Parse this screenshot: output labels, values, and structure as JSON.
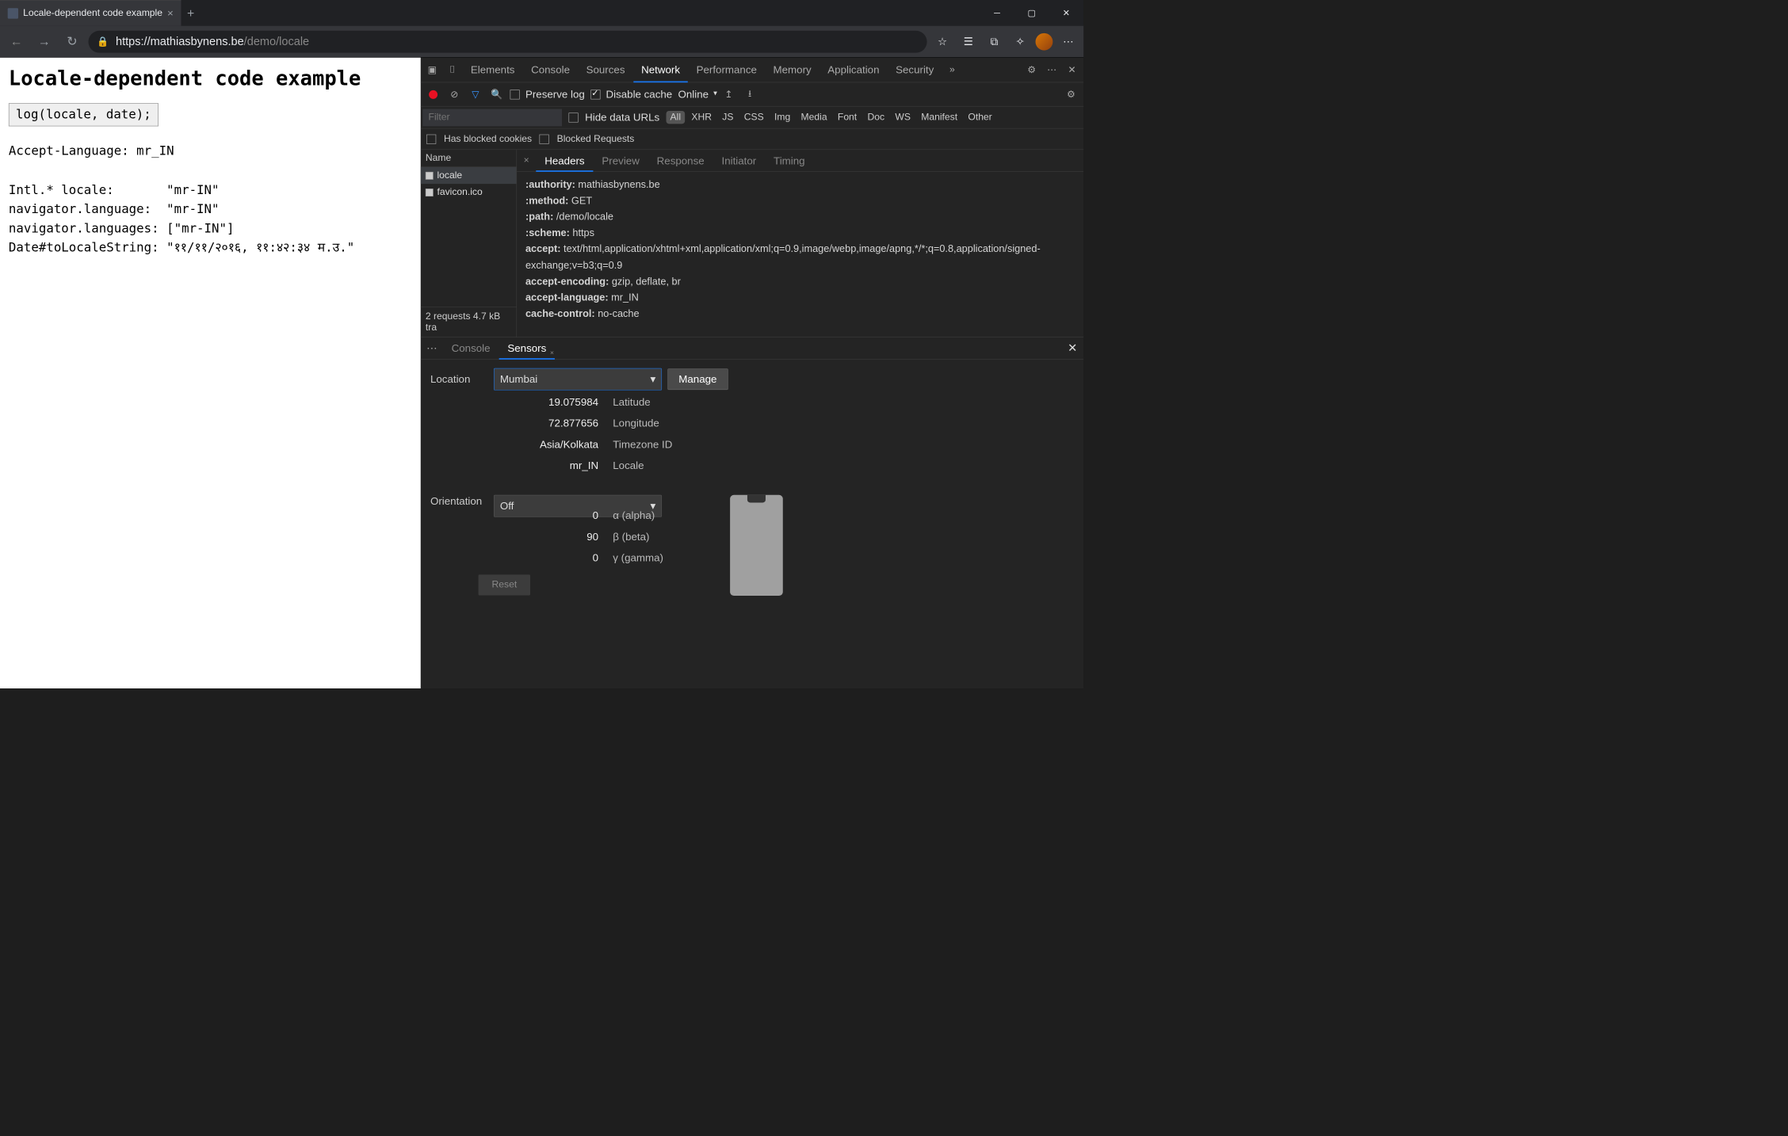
{
  "tab": {
    "title": "Locale-dependent code example"
  },
  "url": {
    "host": "https://mathiasbynens.be",
    "path": "/demo/locale"
  },
  "page": {
    "heading": "Locale-dependent code example",
    "button": "log(locale, date);",
    "lines": "Accept-Language: mr_IN\n\nIntl.* locale:       \"mr-IN\"\nnavigator.language:  \"mr-IN\"\nnavigator.languages: [\"mr-IN\"]\nDate#toLocaleString: \"११/११/२०१६, ११:४२:३४ म.उ.\""
  },
  "devtools": {
    "tabs": [
      "Elements",
      "Console",
      "Sources",
      "Network",
      "Performance",
      "Memory",
      "Application",
      "Security"
    ],
    "active": "Network",
    "toolbar": {
      "preserve": "Preserve log",
      "disable": "Disable cache",
      "online": "Online"
    },
    "filter": {
      "placeholder": "Filter",
      "hide": "Hide data URLs",
      "types": [
        "All",
        "XHR",
        "JS",
        "CSS",
        "Img",
        "Media",
        "Font",
        "Doc",
        "WS",
        "Manifest",
        "Other"
      ],
      "blocked_cookies": "Has blocked cookies",
      "blocked_requests": "Blocked Requests"
    },
    "requests": {
      "col": "Name",
      "items": [
        "locale",
        "favicon.ico"
      ],
      "status": "2 requests  4.7 kB tra"
    },
    "detail": {
      "tabs": [
        "Headers",
        "Preview",
        "Response",
        "Initiator",
        "Timing"
      ],
      "headers": [
        [
          ":authority:",
          "mathiasbynens.be"
        ],
        [
          ":method:",
          "GET"
        ],
        [
          ":path:",
          "/demo/locale"
        ],
        [
          ":scheme:",
          "https"
        ],
        [
          "accept:",
          "text/html,application/xhtml+xml,application/xml;q=0.9,image/webp,image/apng,*/*;q=0.8,application/signed-exchange;v=b3;q=0.9"
        ],
        [
          "accept-encoding:",
          "gzip, deflate, br"
        ],
        [
          "accept-language:",
          "mr_IN"
        ],
        [
          "cache-control:",
          "no-cache"
        ]
      ]
    }
  },
  "drawer": {
    "tabs": [
      "Console",
      "Sensors"
    ],
    "location": {
      "label": "Location",
      "value": "Mumbai",
      "manage": "Manage",
      "rows": [
        [
          "19.075984",
          "Latitude"
        ],
        [
          "72.877656",
          "Longitude"
        ],
        [
          "Asia/Kolkata",
          "Timezone ID"
        ],
        [
          "mr_IN",
          "Locale"
        ]
      ]
    },
    "orientation": {
      "label": "Orientation",
      "value": "Off",
      "rows": [
        [
          "0",
          "α (alpha)"
        ],
        [
          "90",
          "β (beta)"
        ],
        [
          "0",
          "γ (gamma)"
        ]
      ],
      "reset": "Reset"
    }
  }
}
